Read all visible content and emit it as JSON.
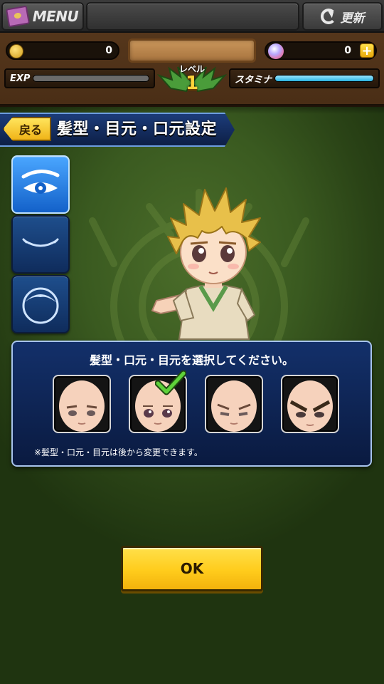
{
  "header": {
    "menu_label": "MENU",
    "refresh_label": "更新",
    "coins": "0",
    "gems": "0",
    "exp_label": "EXP",
    "exp_progress": 0.0,
    "stamina_label": "スタミナ",
    "stamina_progress": 1.0,
    "level_label": "レベル",
    "level_value": "1"
  },
  "title_bar": {
    "back_label": "戻る",
    "title": "髪型・目元・口元設定"
  },
  "side_tabs": [
    {
      "id": "eyes",
      "icon": "eye-icon",
      "active": true
    },
    {
      "id": "mouth",
      "icon": "mouth-icon",
      "active": false
    },
    {
      "id": "hair",
      "icon": "hair-icon",
      "active": false
    }
  ],
  "panel": {
    "instruction": "髪型・口元・目元を選択してください。",
    "note": "※髪型・口元・目元は後から変更できます。",
    "options": [
      {
        "id": "face-1",
        "selected": false
      },
      {
        "id": "face-2",
        "selected": true
      },
      {
        "id": "face-3",
        "selected": false
      },
      {
        "id": "face-4",
        "selected": false
      }
    ]
  },
  "ok_button": {
    "label": "OK"
  },
  "colors": {
    "accent_yellow": "#ffcc1c",
    "panel_blue": "#13306a",
    "check_green": "#5fd23a"
  }
}
